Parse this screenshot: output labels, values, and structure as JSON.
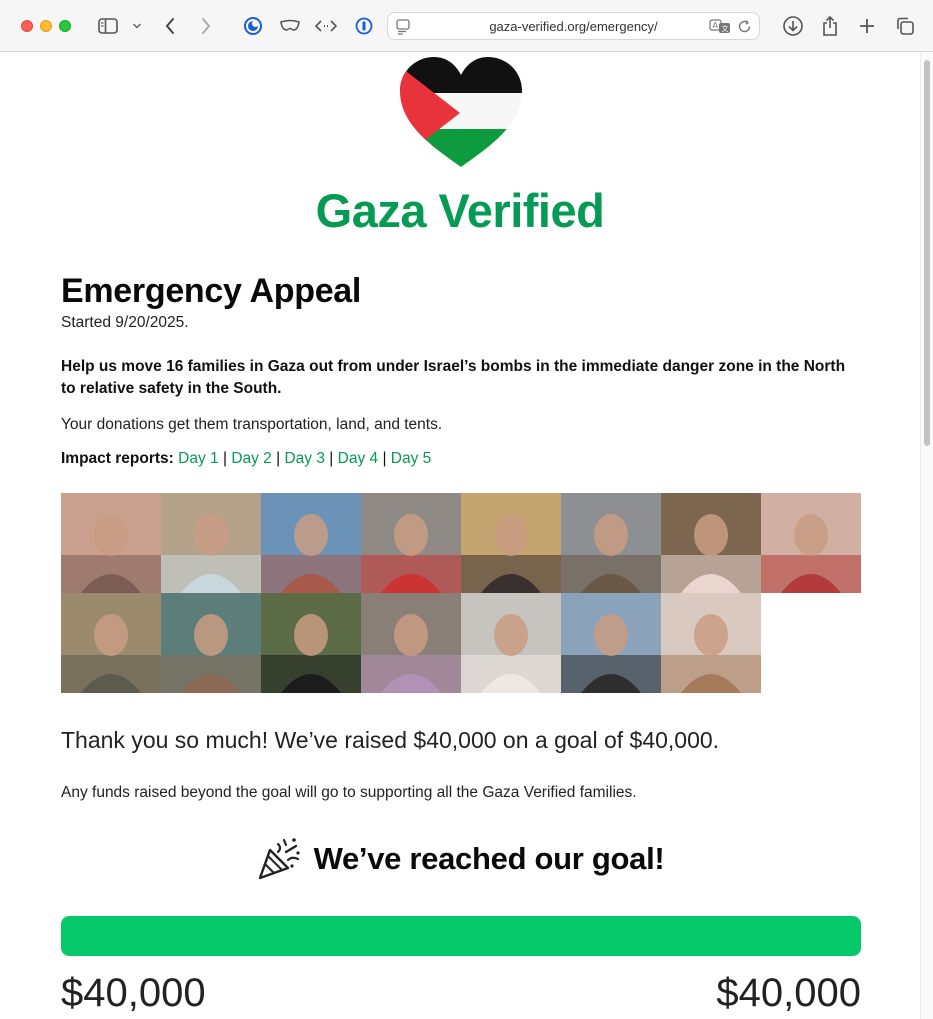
{
  "browser": {
    "url": "gaza-verified.org/emergency/"
  },
  "site": {
    "brand": "Gaza Verified"
  },
  "appeal": {
    "title": "Emergency Appeal",
    "started": "Started 9/20/2025.",
    "lead": "Help us move 16 families in Gaza out from under Israel’s bombs in the immediate danger zone in the North to relative safety in the South.",
    "donations_text": "Your donations get them transportation, land, and tents.",
    "impact_label": "Impact reports:",
    "impact_links": [
      "Day 1",
      "Day 2",
      "Day 3",
      "Day 4",
      "Day 5"
    ],
    "photo_count": 15,
    "thanks": "Thank you so much! We’ve raised $40,000 on a goal of $40,000.",
    "beyond_note": "Any funds raised beyond the goal will go to supporting all the Gaza Verified families.",
    "goal_reached": "We’ve reached our goal!",
    "progress_percent": 100,
    "raised": "$40,000",
    "goal": "$40,000"
  },
  "colors": {
    "brand_green": "#069a54",
    "progress_green": "#05c86a"
  }
}
